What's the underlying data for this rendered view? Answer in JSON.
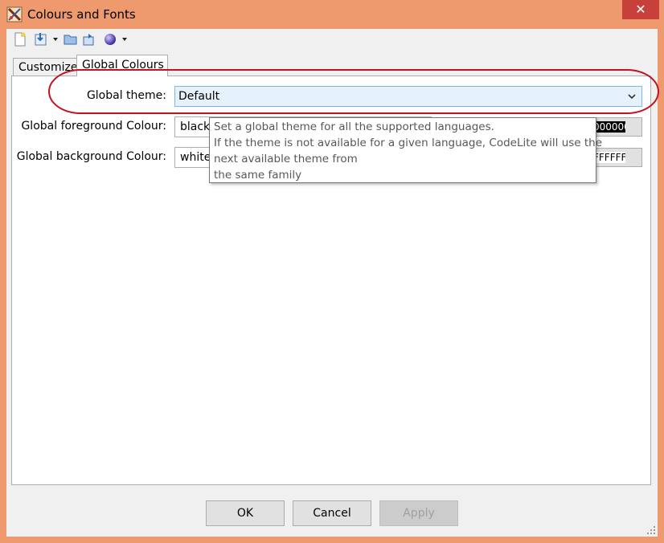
{
  "window": {
    "title": "Colours and Fonts",
    "close_label": "✕"
  },
  "toolbar": {
    "icons": [
      "new-file-icon",
      "import-icon",
      "open-folder-icon",
      "export-icon",
      "theme-sphere-icon"
    ]
  },
  "tabs": [
    {
      "label": "Customize",
      "active": false
    },
    {
      "label": "Global Colours",
      "active": true
    }
  ],
  "global_theme": {
    "label": "Global theme:",
    "value": "Default"
  },
  "foreground": {
    "label": "Global foreground Colour:",
    "value": "black",
    "swatch_text": "000000",
    "swatch_color": "#000000"
  },
  "background": {
    "label": "Global background Colour:",
    "value": "white",
    "swatch_text": "FFFFFF",
    "swatch_color": "#ffffff"
  },
  "tooltip": {
    "lines": [
      "Set a global theme for all the supported languages.",
      "If the theme is not available for a given language, CodeLite will use the",
      "next available theme from",
      "the same family"
    ]
  },
  "buttons": {
    "ok": "OK",
    "cancel": "Cancel",
    "apply": "Apply"
  },
  "colors": {
    "frame": "#ee9a6e",
    "close": "#c7413a",
    "highlight": "#c1121f"
  }
}
